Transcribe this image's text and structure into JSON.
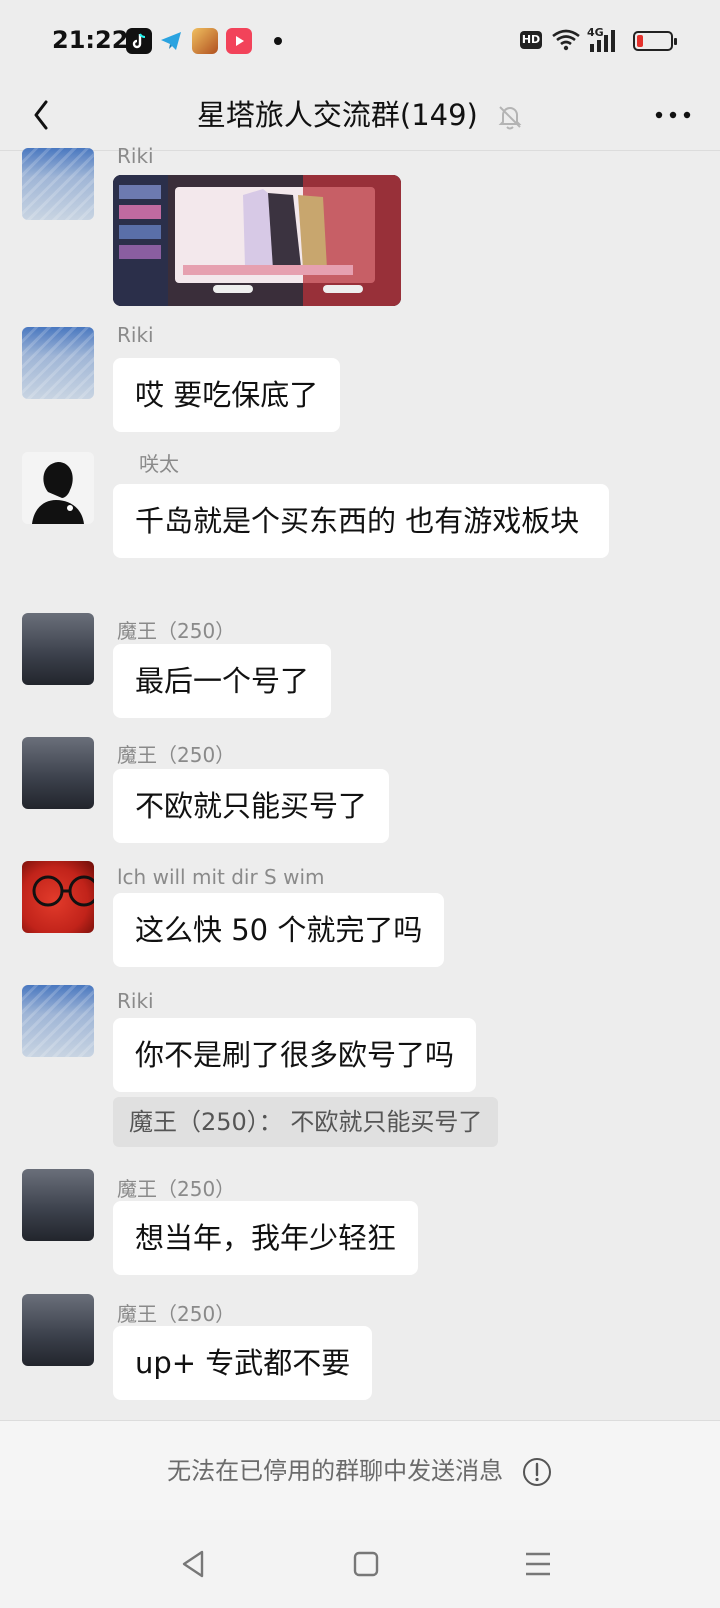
{
  "status_bar": {
    "time": "21:22",
    "apps": [
      "tiktok-icon",
      "telegram-icon",
      "game-icon",
      "video-app-icon"
    ],
    "hd": "HD",
    "network": "4G"
  },
  "header": {
    "title": "星塔旅人交流群(149)"
  },
  "messages": [
    {
      "sender": "Riki",
      "type": "image"
    },
    {
      "sender": "Riki",
      "text": "哎 要吃保底了"
    },
    {
      "sender": "咲太",
      "text": "千岛就是个买东西的  也有游戏板块"
    },
    {
      "sender": "魔王（250）",
      "text": "最后一个号了"
    },
    {
      "sender": "魔王（250）",
      "text": "不欧就只能买号了"
    },
    {
      "sender": "lch will mit dir S wim",
      "text": "这么快 50 个就完了吗"
    },
    {
      "sender": "Riki",
      "text": "你不是刷了很多欧号了吗",
      "quote": "魔王（250）：  不欧就只能买号了"
    },
    {
      "sender": "魔王（250）",
      "text": "想当年，我年少轻狂"
    },
    {
      "sender": "魔王（250）",
      "text": "up+ 专武都不要"
    }
  ],
  "bottom": {
    "disabled_text": "无法在已停用的群聊中发送消息"
  },
  "colors": {
    "background": "#ededed",
    "bubble": "#ffffff",
    "quote": "#e0e0e0",
    "battery_low": "#e5322d"
  }
}
